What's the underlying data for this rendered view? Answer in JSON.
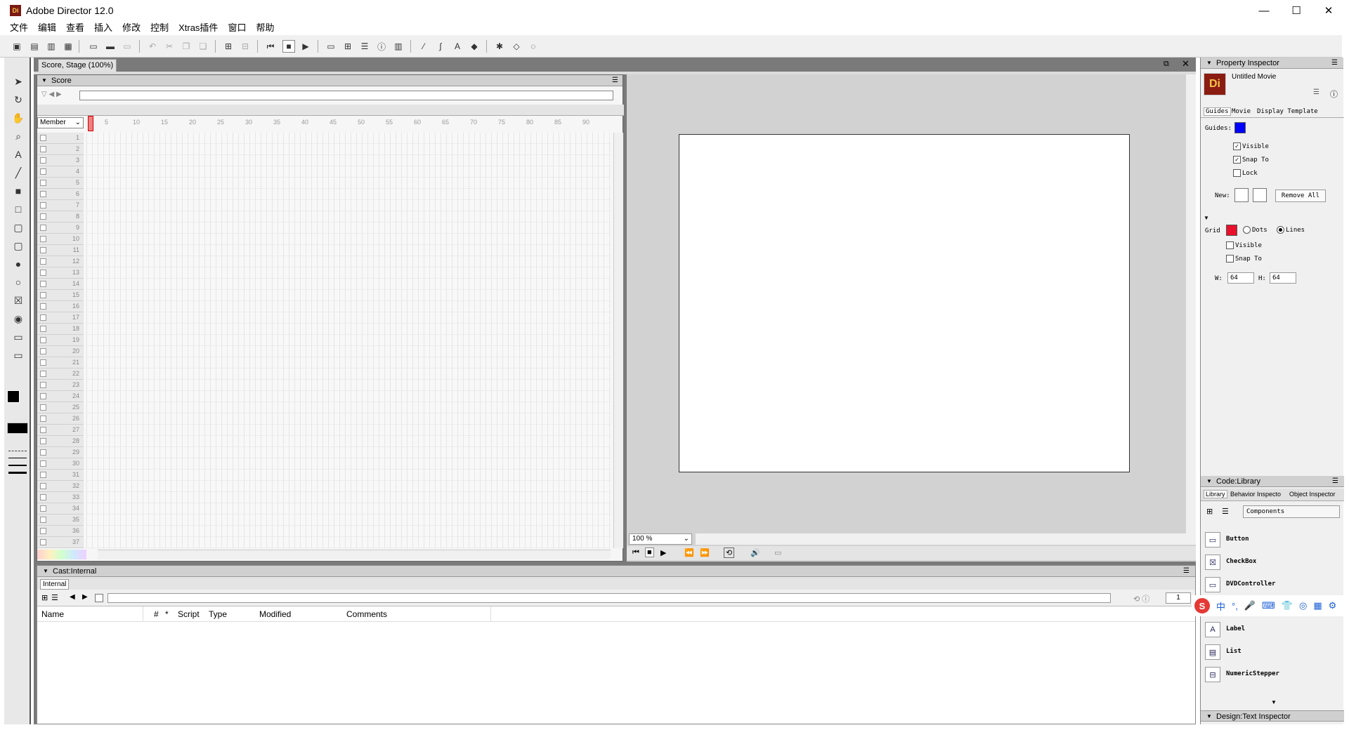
{
  "window": {
    "title": "Adobe Director 12.0",
    "logo": "Di",
    "controls": [
      "—",
      "☐",
      "✕"
    ]
  },
  "menu": [
    "文件",
    "编辑",
    "查看",
    "插入",
    "修改",
    "控制",
    "Xtras插件",
    "窗口",
    "帮助"
  ],
  "document_tab": "Score, Stage (100%)",
  "score": {
    "title": "Score",
    "channel_label": "Member",
    "frame_numbers": [
      "5",
      "10",
      "15",
      "20",
      "25",
      "30",
      "35",
      "40",
      "45",
      "50",
      "55",
      "60",
      "65",
      "70",
      "75",
      "80",
      "85",
      "90"
    ],
    "channels": [
      "1",
      "2",
      "3",
      "4",
      "5",
      "6",
      "7",
      "8",
      "9",
      "10",
      "11",
      "12",
      "13",
      "14",
      "15",
      "16",
      "17",
      "18",
      "19",
      "20",
      "21",
      "22",
      "23",
      "24",
      "25",
      "26",
      "27",
      "28",
      "29",
      "30",
      "31",
      "32",
      "33",
      "34",
      "35",
      "36",
      "37"
    ]
  },
  "stage": {
    "zoom": "100 %"
  },
  "cast": {
    "title": "Cast:Internal",
    "tab": "Internal",
    "page": "1",
    "columns": [
      "Name",
      "#",
      "*",
      "Script",
      "Type",
      "Modified",
      "Comments"
    ]
  },
  "property_inspector": {
    "title": "Property Inspector",
    "movie_name": "Untitled Movie",
    "tabs": [
      "Guides",
      "Movie",
      "Display Template"
    ],
    "guides_label": "Guides:",
    "guide_color": "#0000ff",
    "guide_visible": "Visible",
    "guide_snap": "Snap To",
    "guide_lock": "Lock",
    "new_label": "New:",
    "remove_all": "Remove All",
    "grid_label": "Grid",
    "grid_color": "#e8102a",
    "dots": "Dots",
    "lines": "Lines",
    "grid_visible": "Visible",
    "grid_snap": "Snap To",
    "w_label": "W:",
    "w_value": "64",
    "h_label": "H:",
    "h_value": "64"
  },
  "code_library": {
    "title": "Code:Library",
    "tabs": [
      "Library",
      "Behavior Inspecto",
      "Object Inspector"
    ],
    "category": "Components",
    "items": [
      "Button",
      "CheckBox",
      "DVDController",
      "",
      "Label",
      "List",
      "NumericStepper"
    ]
  },
  "design_panel": "Design:Text Inspector",
  "ime": {
    "mode": "中",
    "punct": "°,",
    "logo": "S"
  }
}
